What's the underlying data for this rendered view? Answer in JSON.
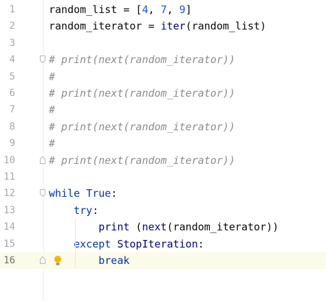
{
  "editor": {
    "current_line": 16,
    "lines": [
      {
        "n": "1",
        "tokens": [
          [
            "plain",
            "random_list = ["
          ],
          [
            "num",
            "4"
          ],
          [
            "plain",
            ", "
          ],
          [
            "num",
            "7"
          ],
          [
            "plain",
            ", "
          ],
          [
            "num",
            "9"
          ],
          [
            "plain",
            "]"
          ]
        ]
      },
      {
        "n": "2",
        "tokens": [
          [
            "plain",
            "random_iterator = "
          ],
          [
            "builtin",
            "iter"
          ],
          [
            "plain",
            "(random_list)"
          ]
        ]
      },
      {
        "n": "3",
        "tokens": []
      },
      {
        "n": "4",
        "tokens": [
          [
            "cmt",
            "# print(next(random_iterator))"
          ]
        ],
        "fold": "start"
      },
      {
        "n": "5",
        "tokens": [
          [
            "cmt",
            "#"
          ]
        ]
      },
      {
        "n": "6",
        "tokens": [
          [
            "cmt",
            "# print(next(random_iterator))"
          ]
        ]
      },
      {
        "n": "7",
        "tokens": [
          [
            "cmt",
            "#"
          ]
        ]
      },
      {
        "n": "8",
        "tokens": [
          [
            "cmt",
            "# print(next(random_iterator))"
          ]
        ]
      },
      {
        "n": "9",
        "tokens": [
          [
            "cmt",
            "#"
          ]
        ]
      },
      {
        "n": "10",
        "tokens": [
          [
            "cmt",
            "# print(next(random_iterator))"
          ]
        ],
        "fold": "end"
      },
      {
        "n": "11",
        "tokens": []
      },
      {
        "n": "12",
        "tokens": [
          [
            "kw",
            "while "
          ],
          [
            "kw",
            "True"
          ],
          [
            "plain",
            ":"
          ]
        ],
        "fold": "start"
      },
      {
        "n": "13",
        "tokens": [
          [
            "plain",
            "    "
          ],
          [
            "kw",
            "try"
          ],
          [
            "plain",
            ":"
          ]
        ]
      },
      {
        "n": "14",
        "tokens": [
          [
            "plain",
            "        "
          ],
          [
            "builtin",
            "print"
          ],
          [
            "plain",
            " ("
          ],
          [
            "builtin",
            "next"
          ],
          [
            "plain",
            "(random_iterator))"
          ]
        ]
      },
      {
        "n": "15",
        "tokens": [
          [
            "plain",
            "    "
          ],
          [
            "kw",
            "except "
          ],
          [
            "builtin",
            "StopIteration"
          ],
          [
            "plain",
            ":"
          ]
        ]
      },
      {
        "n": "16",
        "tokens": [
          [
            "plain",
            "        "
          ],
          [
            "kw",
            "break"
          ]
        ],
        "fold": "end",
        "intention": "lightbulb-icon"
      }
    ]
  },
  "colors": {
    "keyword": "#0033b3",
    "number": "#1750eb",
    "builtin": "#000080",
    "comment": "#8c8c8c",
    "current_line_bg": "#fcfae8",
    "lightbulb": "#f5b800"
  }
}
